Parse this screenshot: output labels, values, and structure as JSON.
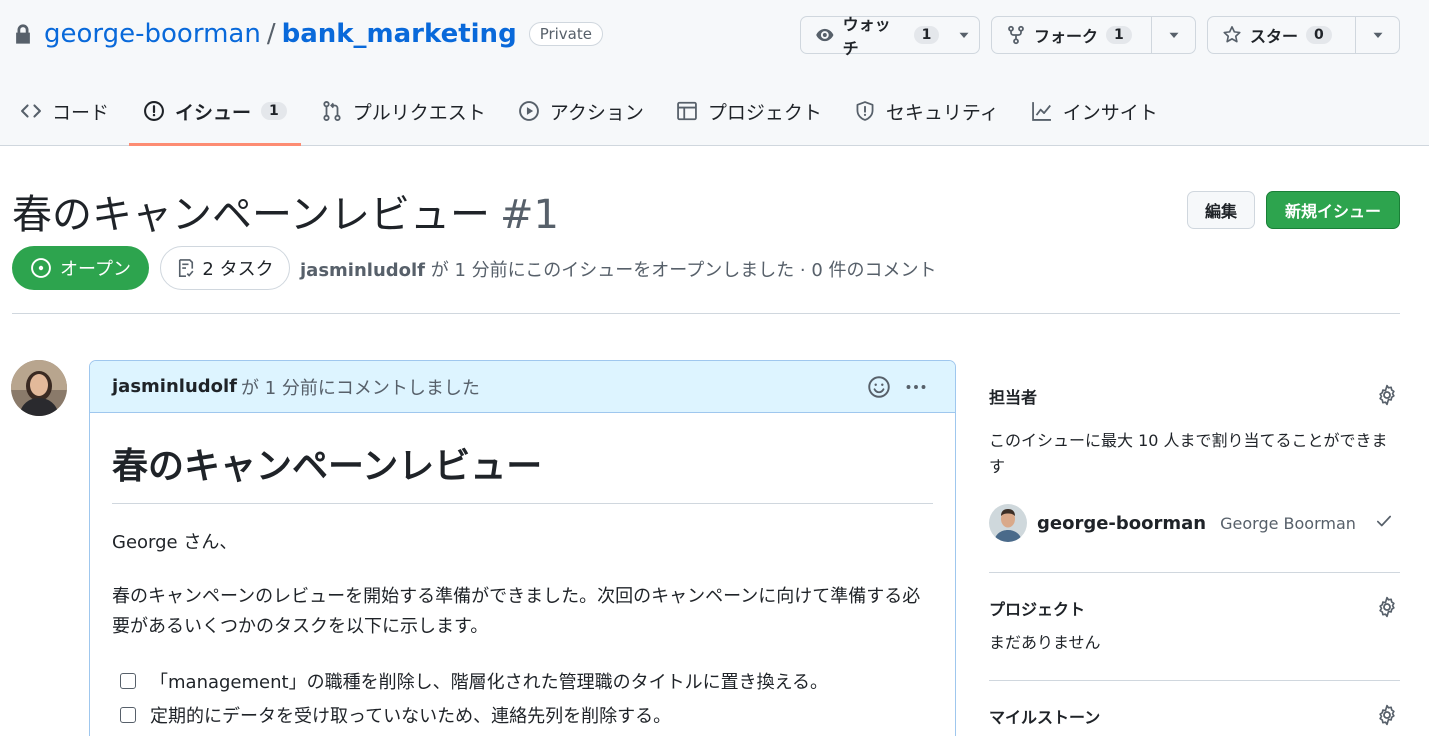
{
  "repo": {
    "owner": "george-boorman",
    "separator": "/",
    "name": "bank_marketing",
    "visibility": "Private",
    "watch": {
      "label": "ウォッチ",
      "count": "1"
    },
    "fork": {
      "label": "フォーク",
      "count": "1"
    },
    "star": {
      "label": "スター",
      "count": "0"
    }
  },
  "nav": {
    "code": "コード",
    "issues": "イシュー",
    "issues_count": "1",
    "pulls": "プルリクエスト",
    "actions": "アクション",
    "projects": "プロジェクト",
    "security": "セキュリティ",
    "insights": "インサイト"
  },
  "issue": {
    "title": "春のキャンペーンレビュー",
    "number": "#1",
    "edit_label": "編集",
    "new_label": "新規イシュー",
    "state": "オープン",
    "tasks": "2 タスク",
    "author": "jasminludolf",
    "meta_text": " が 1 分前にこのイシューをオープンしました · 0 件のコメント"
  },
  "comment": {
    "author": "jasminludolf",
    "header_text": "が 1 分前にコメントしました",
    "heading": "春のキャンペーンレビュー",
    "greeting": "George さん、",
    "paragraph": "春のキャンペーンのレビューを開始する準備ができました。次回のキャンペーンに向けて準備する必要があるいくつかのタスクを以下に示します。",
    "tasks": [
      "「management」の職種を削除し、階層化された管理職のタイトルに置き換える。",
      "定期的にデータを受け取っていないため、連絡先列を削除する。"
    ]
  },
  "sidebar": {
    "assignees_title": "担当者",
    "assignees_hint": "このイシューに最大 10 人まで割り当てることができます",
    "assignee_login": "george-boorman",
    "assignee_name": "George Boorman",
    "projects_title": "プロジェクト",
    "projects_empty": "まだありません",
    "milestone_title": "マイルストーン"
  },
  "colors": {
    "accent_green": "#2da44e",
    "link_blue": "#0969da",
    "nav_underline": "#fd8c73",
    "comment_header_bg": "#ddf4ff"
  },
  "icons": [
    "lock-icon",
    "eye-icon",
    "fork-icon",
    "star-icon",
    "code-icon",
    "issue-opened-icon",
    "pull-request-icon",
    "play-icon",
    "table-icon",
    "shield-icon",
    "graph-icon",
    "checklist-icon",
    "smiley-icon",
    "kebab-icon",
    "gear-icon",
    "check-icon",
    "chevron-down-icon"
  ]
}
